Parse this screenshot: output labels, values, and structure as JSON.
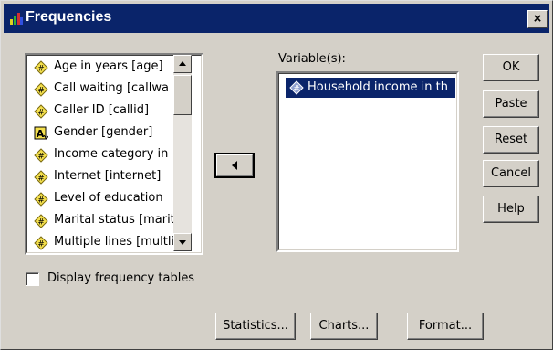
{
  "window": {
    "title": "Frequencies",
    "close_label": "×"
  },
  "source_list": {
    "items": [
      {
        "label": "Age in years [age]",
        "icon": "numeric-variable-icon"
      },
      {
        "label": "Call waiting [callwa",
        "icon": "numeric-variable-icon"
      },
      {
        "label": "Caller ID [callid]",
        "icon": "numeric-variable-icon"
      },
      {
        "label": "Gender [gender]",
        "icon": "string-variable-icon"
      },
      {
        "label": "Income category in",
        "icon": "numeric-variable-icon"
      },
      {
        "label": "Internet [internet]",
        "icon": "numeric-variable-icon"
      },
      {
        "label": "Level of education",
        "icon": "numeric-variable-icon"
      },
      {
        "label": "Marital status [marit",
        "icon": "numeric-variable-icon"
      },
      {
        "label": "Multiple lines [multli",
        "icon": "numeric-variable-icon"
      }
    ]
  },
  "target": {
    "label": "Variable(s):",
    "items": [
      {
        "label": "Household income in th",
        "icon": "scale-variable-icon",
        "selected": true
      }
    ]
  },
  "buttons": {
    "ok": "OK",
    "paste": "Paste",
    "reset": "Reset",
    "cancel": "Cancel",
    "help": "Help",
    "statistics": "Statistics...",
    "charts": "Charts...",
    "format": "Format..."
  },
  "checkbox": {
    "label": "Display frequency tables",
    "checked": false
  },
  "colors": {
    "titlebar": "#0a246a",
    "selection": "#0a246a",
    "dialog_face": "#d4d0c8",
    "variable_icon_fill": "#f4e04d"
  }
}
